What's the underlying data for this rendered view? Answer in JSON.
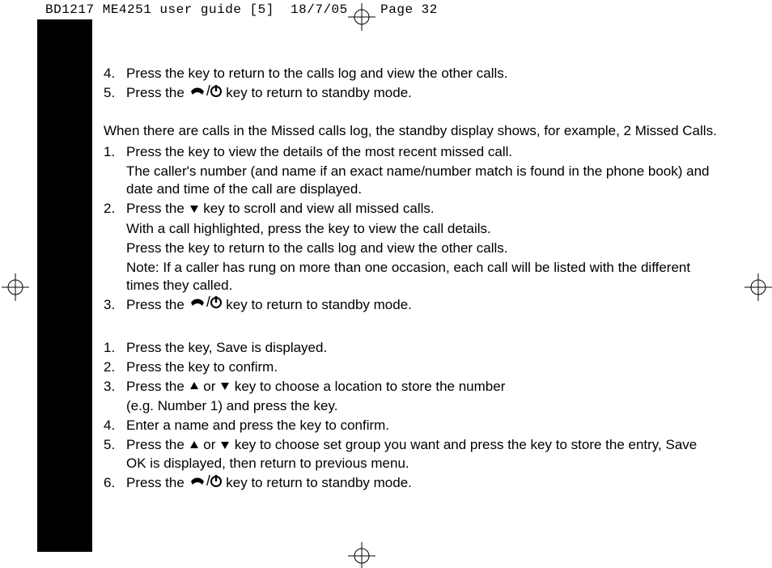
{
  "header": {
    "doc_id": "BD1217 ME4251 user guide [5]",
    "date": "18/7/05",
    "page_label": "Page 32"
  },
  "listA": [
    {
      "num": "4.",
      "lines": [
        "Press the       key to return to the calls log and view the other calls."
      ]
    },
    {
      "num": "5.",
      "lines": [
        "Press the {END} key to return to standby mode."
      ]
    }
  ],
  "intro": "When there are calls in the Missed calls log, the standby display shows, for example, 2 Missed Calls.",
  "listB": [
    {
      "num": "1.",
      "lines": [
        "Press the       key to view the details of the most recent missed call.",
        "The caller's number (and name if an exact name/number match is found in the phone book) and date and time of the call are displayed."
      ]
    },
    {
      "num": "2.",
      "lines": [
        "Press the {DOWN} key to scroll and view all missed calls.",
        "With a call highlighted, press the       key to view the call details.",
        "Press the       key to return to the calls log and view the other calls.",
        "Note: If a caller has rung on more than one occasion, each call will be listed with the different times they called."
      ]
    },
    {
      "num": "3.",
      "lines": [
        "Press the {END} key to return to standby mode."
      ]
    }
  ],
  "listC": [
    {
      "num": "1.",
      "lines": [
        "Press the       key, Save is displayed."
      ]
    },
    {
      "num": "2.",
      "lines": [
        "Press the       key to confirm."
      ]
    },
    {
      "num": "3.",
      "lines": [
        "Press the {UP} or {DOWN} key to choose a location to store the number",
        "(e.g. Number 1) and press the        key."
      ]
    },
    {
      "num": "4.",
      "lines": [
        "Enter a name and press the        key to confirm."
      ]
    },
    {
      "num": "5.",
      "lines": [
        "Press the  {UP} or {DOWN} key to choose set group you want and press the        key to store the entry, Save OK is displayed, then return to previous menu."
      ]
    },
    {
      "num": "6.",
      "lines": [
        "Press the {END} key to return to standby mode."
      ]
    }
  ]
}
